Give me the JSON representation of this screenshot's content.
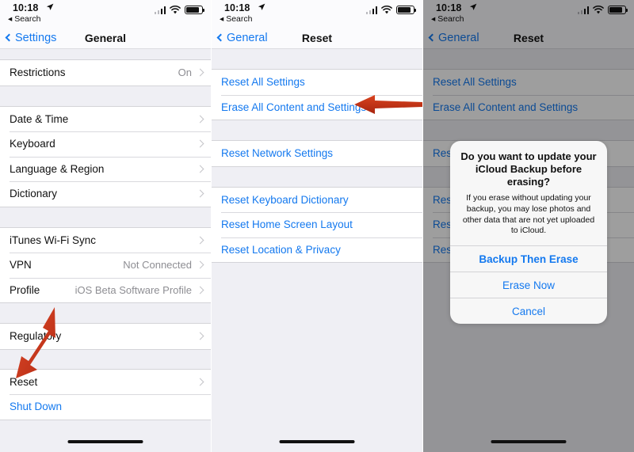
{
  "status_bar": {
    "time": "10:18",
    "location_icon": "location-arrow-icon",
    "back_to_app": "Search",
    "cellular_icon": "cellular-bars-icon",
    "wifi_icon": "wifi-icon",
    "battery_icon": "battery-icon"
  },
  "colors": {
    "accent_blue": "#1479ef",
    "list_bg": "#efeff4",
    "row_bg": "#ffffff",
    "secondary_text": "#8e8e93",
    "arrow_red": "#c0301c"
  },
  "panels": [
    {
      "id": "general-settings",
      "nav": {
        "back_label": "Settings",
        "title": "General"
      },
      "groups": [
        {
          "rows": [
            {
              "label": "Restrictions",
              "value": "On",
              "disclosure": true,
              "style": "normal"
            }
          ]
        },
        {
          "rows": [
            {
              "label": "Date & Time",
              "value": "",
              "disclosure": true,
              "style": "normal"
            },
            {
              "label": "Keyboard",
              "value": "",
              "disclosure": true,
              "style": "normal"
            },
            {
              "label": "Language & Region",
              "value": "",
              "disclosure": true,
              "style": "normal"
            },
            {
              "label": "Dictionary",
              "value": "",
              "disclosure": true,
              "style": "normal"
            }
          ]
        },
        {
          "rows": [
            {
              "label": "iTunes Wi-Fi Sync",
              "value": "",
              "disclosure": true,
              "style": "normal"
            },
            {
              "label": "VPN",
              "value": "Not Connected",
              "disclosure": true,
              "style": "normal"
            },
            {
              "label": "Profile",
              "value": "iOS Beta Software Profile",
              "disclosure": true,
              "style": "normal"
            }
          ]
        },
        {
          "rows": [
            {
              "label": "Regulatory",
              "value": "",
              "disclosure": true,
              "style": "normal"
            }
          ]
        },
        {
          "rows": [
            {
              "label": "Reset",
              "value": "",
              "disclosure": true,
              "style": "normal"
            },
            {
              "label": "Shut Down",
              "value": "",
              "disclosure": false,
              "style": "link"
            }
          ]
        }
      ],
      "annotation_arrow": {
        "name": "red-arrow-pointing-to-reset",
        "direction": "down-left",
        "target": "Reset"
      }
    },
    {
      "id": "reset-menu",
      "nav": {
        "back_label": "General",
        "title": "Reset"
      },
      "groups": [
        {
          "rows": [
            {
              "label": "Reset All Settings",
              "value": "",
              "disclosure": false,
              "style": "link"
            },
            {
              "label": "Erase All Content and Settings",
              "value": "",
              "disclosure": false,
              "style": "link"
            }
          ]
        },
        {
          "rows": [
            {
              "label": "Reset Network Settings",
              "value": "",
              "disclosure": false,
              "style": "link"
            }
          ]
        },
        {
          "rows": [
            {
              "label": "Reset Keyboard Dictionary",
              "value": "",
              "disclosure": false,
              "style": "link"
            },
            {
              "label": "Reset Home Screen Layout",
              "value": "",
              "disclosure": false,
              "style": "link"
            },
            {
              "label": "Reset Location & Privacy",
              "value": "",
              "disclosure": false,
              "style": "link"
            }
          ]
        }
      ],
      "annotation_arrow": {
        "name": "red-arrow-pointing-to-erase-all",
        "direction": "left",
        "target": "Erase All Content and Settings"
      }
    },
    {
      "id": "reset-menu-with-alert",
      "nav": {
        "back_label": "General",
        "title": "Reset"
      },
      "groups": [
        {
          "rows": [
            {
              "label": "Reset All Settings",
              "value": "",
              "disclosure": false,
              "style": "link"
            },
            {
              "label": "Erase All Content and Settings",
              "value": "",
              "disclosure": false,
              "style": "link"
            }
          ]
        },
        {
          "rows": [
            {
              "label": "Reset Network Settings",
              "value": "",
              "disclosure": false,
              "style": "link"
            }
          ]
        },
        {
          "rows": [
            {
              "label": "Reset Keyboard Dictionary",
              "value": "",
              "disclosure": false,
              "style": "link"
            },
            {
              "label": "Reset Home Screen Layout",
              "value": "",
              "disclosure": false,
              "style": "link"
            },
            {
              "label": "Reset Location & Privacy",
              "value": "",
              "disclosure": false,
              "style": "link"
            }
          ]
        }
      ],
      "alert": {
        "title": "Do you want to update your iCloud Backup before erasing?",
        "message": "If you erase without updating your backup, you may lose photos and other data that are not yet uploaded to iCloud.",
        "buttons": [
          {
            "label": "Backup Then Erase",
            "emphasis": "bold"
          },
          {
            "label": "Erase Now",
            "emphasis": "normal"
          },
          {
            "label": "Cancel",
            "emphasis": "normal"
          }
        ]
      }
    }
  ]
}
